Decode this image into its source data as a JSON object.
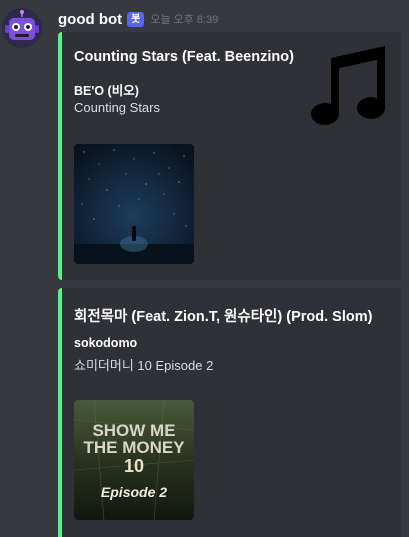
{
  "author": {
    "name": "good bot",
    "bot_tag": "봇",
    "timestamp": "오늘 오후 8:39",
    "avatar_icon": "robot-face-icon"
  },
  "embeds": [
    {
      "title": "Counting Stars (Feat. Beenzino)",
      "artist": "BE'O (비오)",
      "album": "Counting Stars",
      "thumbnail_icon": "music-note-icon",
      "image": "starry-night-album-art",
      "accent_color": "#57f287"
    },
    {
      "title": "회전목마 (Feat. Zion.T, 원슈타인) (Prod. Slom)",
      "artist": "sokodomo",
      "album": "쇼미더머니 10 Episode 2",
      "image": "show-me-the-money-10-album-art",
      "image_text": "SHOW ME THE MONEY 10 Episode 2",
      "accent_color": "#57f287"
    }
  ]
}
